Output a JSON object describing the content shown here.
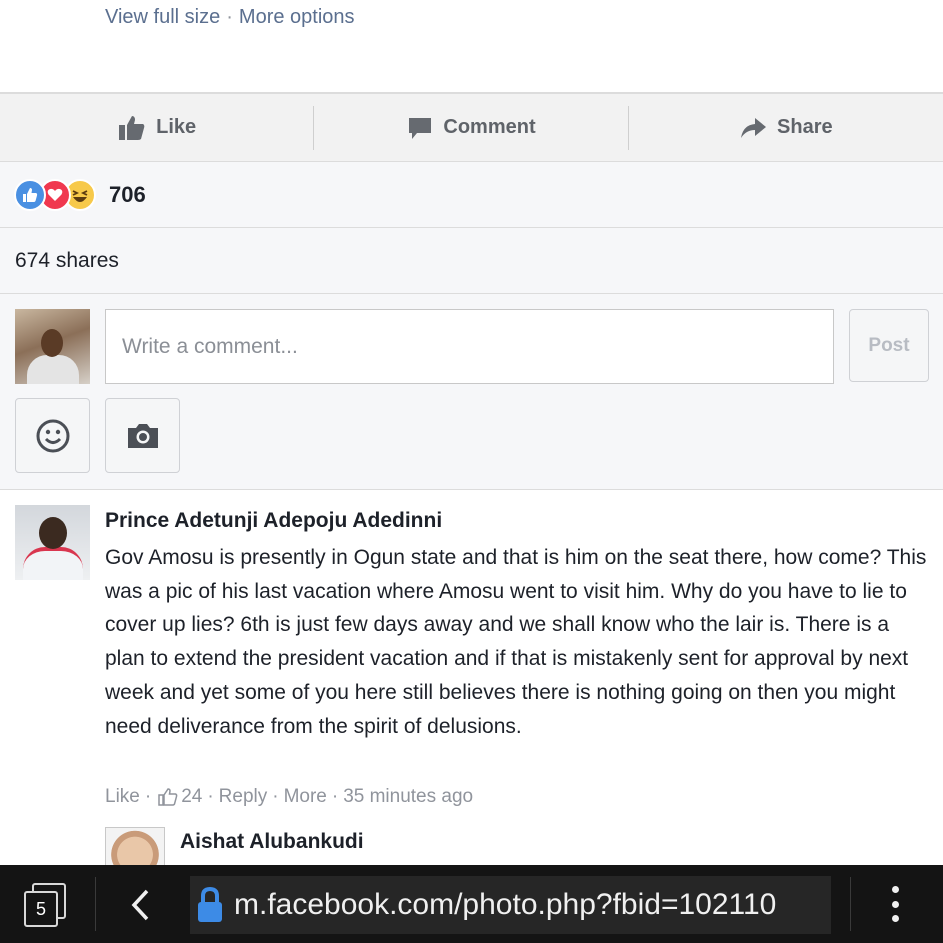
{
  "photo_links": {
    "view_full_size": "View full size",
    "separator": "·",
    "more_options": "More options"
  },
  "actions": {
    "like": "Like",
    "comment": "Comment",
    "share": "Share"
  },
  "reactions": {
    "count": "706",
    "types": [
      "like",
      "love",
      "haha"
    ],
    "colors": {
      "like": "#4a90e2",
      "love": "#f0384f",
      "haha": "#f7c94a"
    }
  },
  "shares": {
    "text": "674 shares"
  },
  "composer": {
    "placeholder": "Write a comment...",
    "post_label": "Post",
    "tools": [
      "emoji-icon",
      "camera-icon"
    ]
  },
  "comment": {
    "author": "Prince Adetunji Adepoju Adedinni",
    "text": "Gov Amosu is presently in Ogun state and that is him on the seat there, how come? This was a pic of his last vacation where Amosu went to visit him. Why do you have to lie to cover up lies? 6th is just few days away and we shall know who the lair is. There is a plan to extend the president vacation and if that is mistakenly sent for approval by next week and yet some of you here still believes there is nothing going on then you might need deliverance from the spirit of delusions.",
    "meta": {
      "like": "Like",
      "like_count": "24",
      "reply": "Reply",
      "more": "More",
      "time": "35 minutes ago",
      "separator": "·"
    }
  },
  "reply": {
    "author": "Aishat Alubankudi"
  },
  "browser": {
    "tab_count": "5",
    "url": "m.facebook.com/photo.php?fbid=102110"
  }
}
